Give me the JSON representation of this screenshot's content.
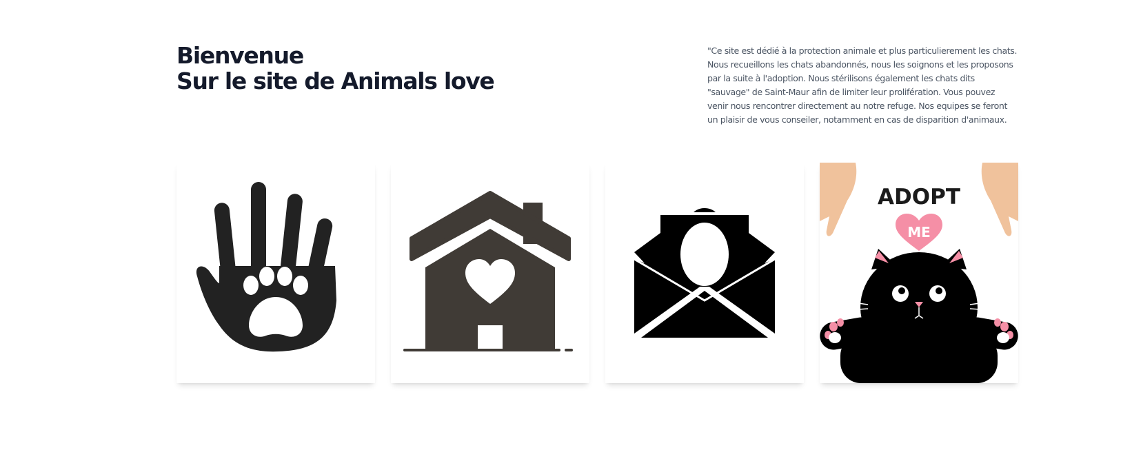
{
  "hero": {
    "title_line1": "Bienvenue",
    "title_line2": "Sur le site de Animals love",
    "description": "\"Ce site est dédié à la protection animale et plus particulierement les chats. Nous recueillons les chats abandonnés, nous les soignons et les proposons par la suite à l'adoption. Nous stérilisons également les chats dits \"sauvage\" de Saint-Maur afin de limiter leur prolifération. Vous pouvez venir nous rencontrer directement au notre refuge. Nos equipes se feront un plaisir de vous conseiler, notamment en cas de disparition d'animaux."
  },
  "cards": [
    {
      "icon": "hand-paw-icon"
    },
    {
      "icon": "house-heart-icon"
    },
    {
      "icon": "envelope-egg-icon"
    },
    {
      "icon": "adopt-me-cat-icon",
      "text_top": "ADOPT",
      "text_heart": "ME"
    }
  ],
  "colors": {
    "heading": "#141a2b",
    "body_text": "#4b5563",
    "icon_dark": "#222222",
    "house": "#403b36",
    "skin": "#f0c29c",
    "heart_pink": "#f58fa6"
  }
}
